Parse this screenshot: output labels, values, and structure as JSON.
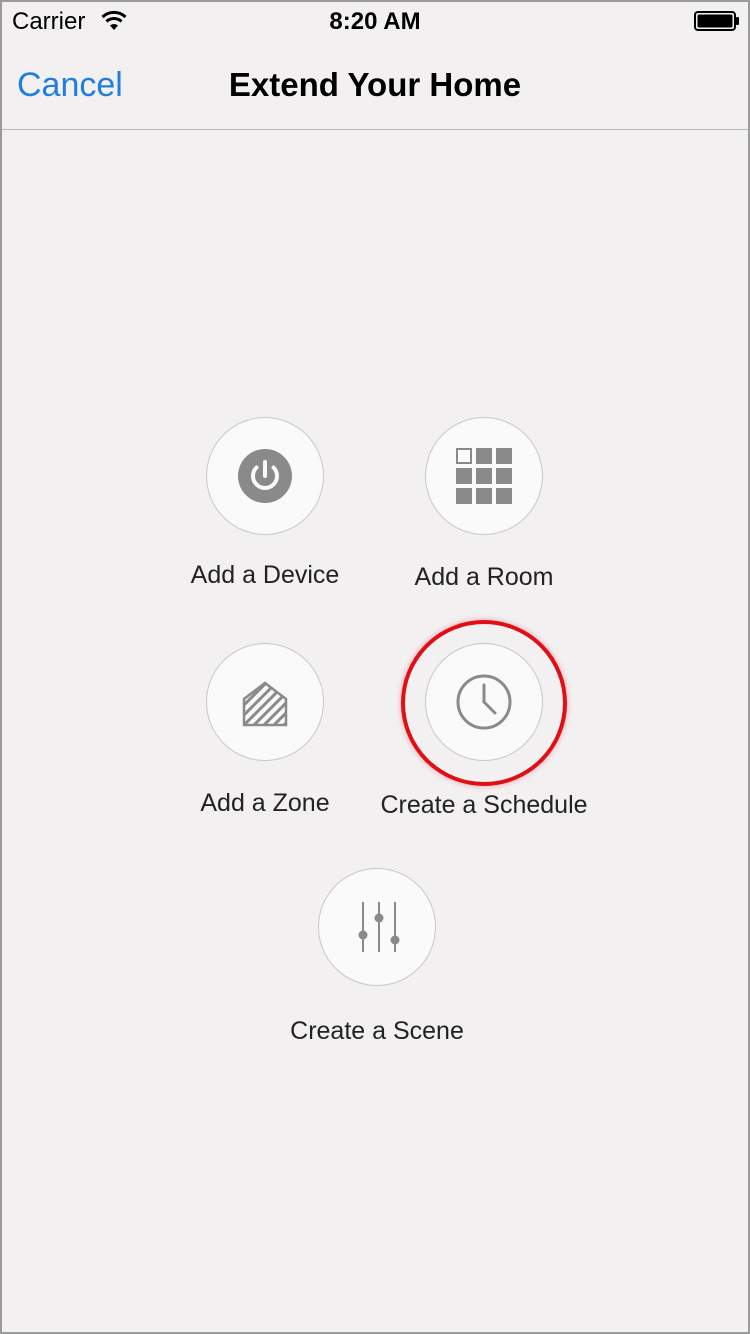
{
  "status_bar": {
    "carrier": "Carrier",
    "time": "8:20 AM",
    "wifi_icon": "wifi-icon",
    "battery_icon": "battery-icon"
  },
  "nav": {
    "cancel_label": "Cancel",
    "title": "Extend Your Home"
  },
  "actions": [
    {
      "label": "Add a Device",
      "icon": "power-icon"
    },
    {
      "label": "Add a Room",
      "icon": "grid-icon"
    },
    {
      "label": "Add a Zone",
      "icon": "zone-house-icon"
    },
    {
      "label": "Create a Schedule",
      "icon": "clock-icon",
      "highlighted": true
    },
    {
      "label": "Create a Scene",
      "icon": "sliders-icon"
    }
  ],
  "colors": {
    "accent": "#1f7fdd",
    "highlight": "#e00e15",
    "icon_gray": "#8a8a8a",
    "background": "#f2f0f1"
  }
}
